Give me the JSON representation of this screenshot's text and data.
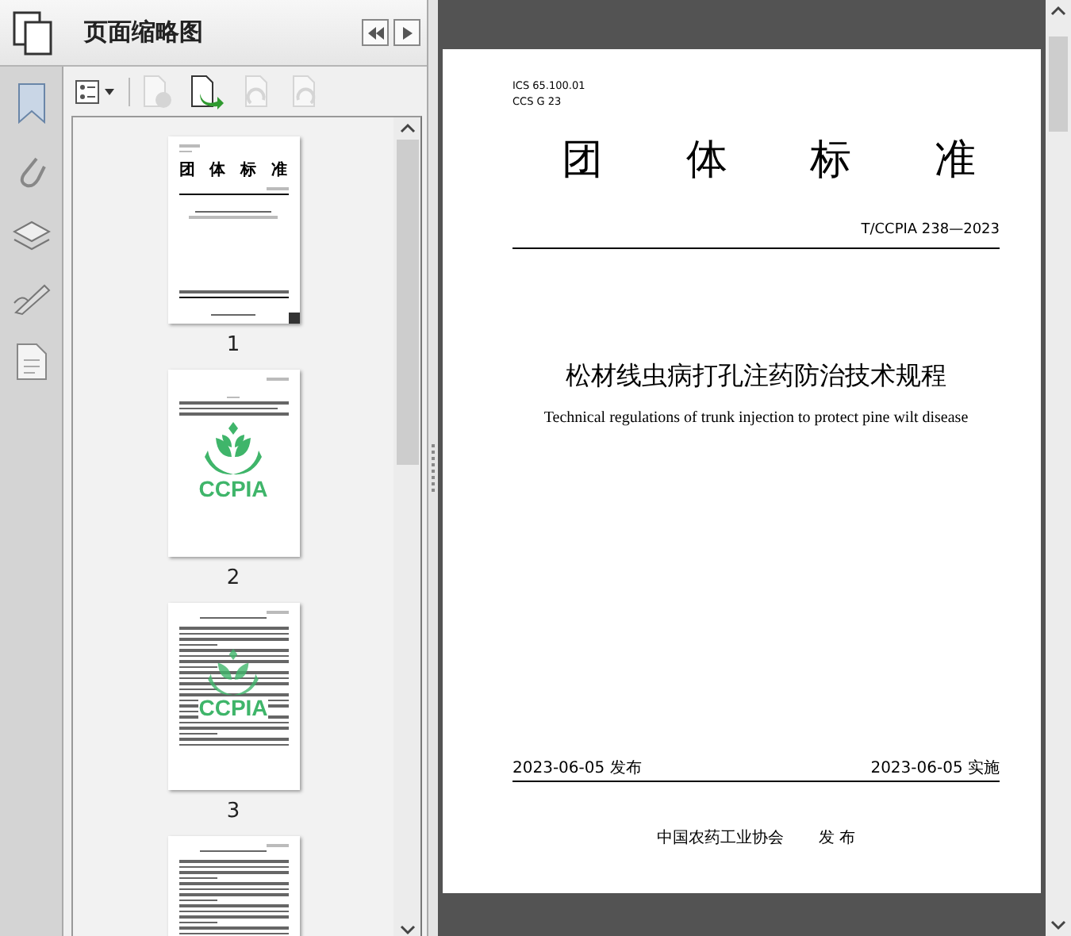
{
  "sidebar": {
    "title": "页面缩略图",
    "toolbar": [
      {
        "kind": "options",
        "disabled": false
      },
      {
        "kind": "delete",
        "disabled": true
      },
      {
        "kind": "insert",
        "disabled": false
      },
      {
        "kind": "rotate-left",
        "disabled": true
      },
      {
        "kind": "rotate-right",
        "disabled": true
      }
    ],
    "thumbnails": [
      {
        "kind": "cover",
        "heading": "团 体 标 准",
        "page_label": "1",
        "selected": true
      },
      {
        "kind": "logo",
        "logo_text": "CCPIA",
        "page_label": "2",
        "selected": false
      },
      {
        "kind": "text",
        "logo_text": "CCPIA",
        "page_label": "3",
        "selected": false
      },
      {
        "kind": "text",
        "selected": false
      }
    ]
  },
  "document": {
    "ics": "ICS  65.100.01",
    "ccs": "CCS  G 23",
    "heading": "团 体 标 准",
    "code": "T/CCPIA 238—2023",
    "title_cn": "松材线虫病打孔注药防治技术规程",
    "title_en": "Technical regulations of trunk injection to protect pine wilt disease",
    "publish_date": "2023-06-05 发布",
    "effective_date": "2023-06-05 实施",
    "publisher": "中国农药工业协会",
    "publisher_action": "发 布"
  }
}
